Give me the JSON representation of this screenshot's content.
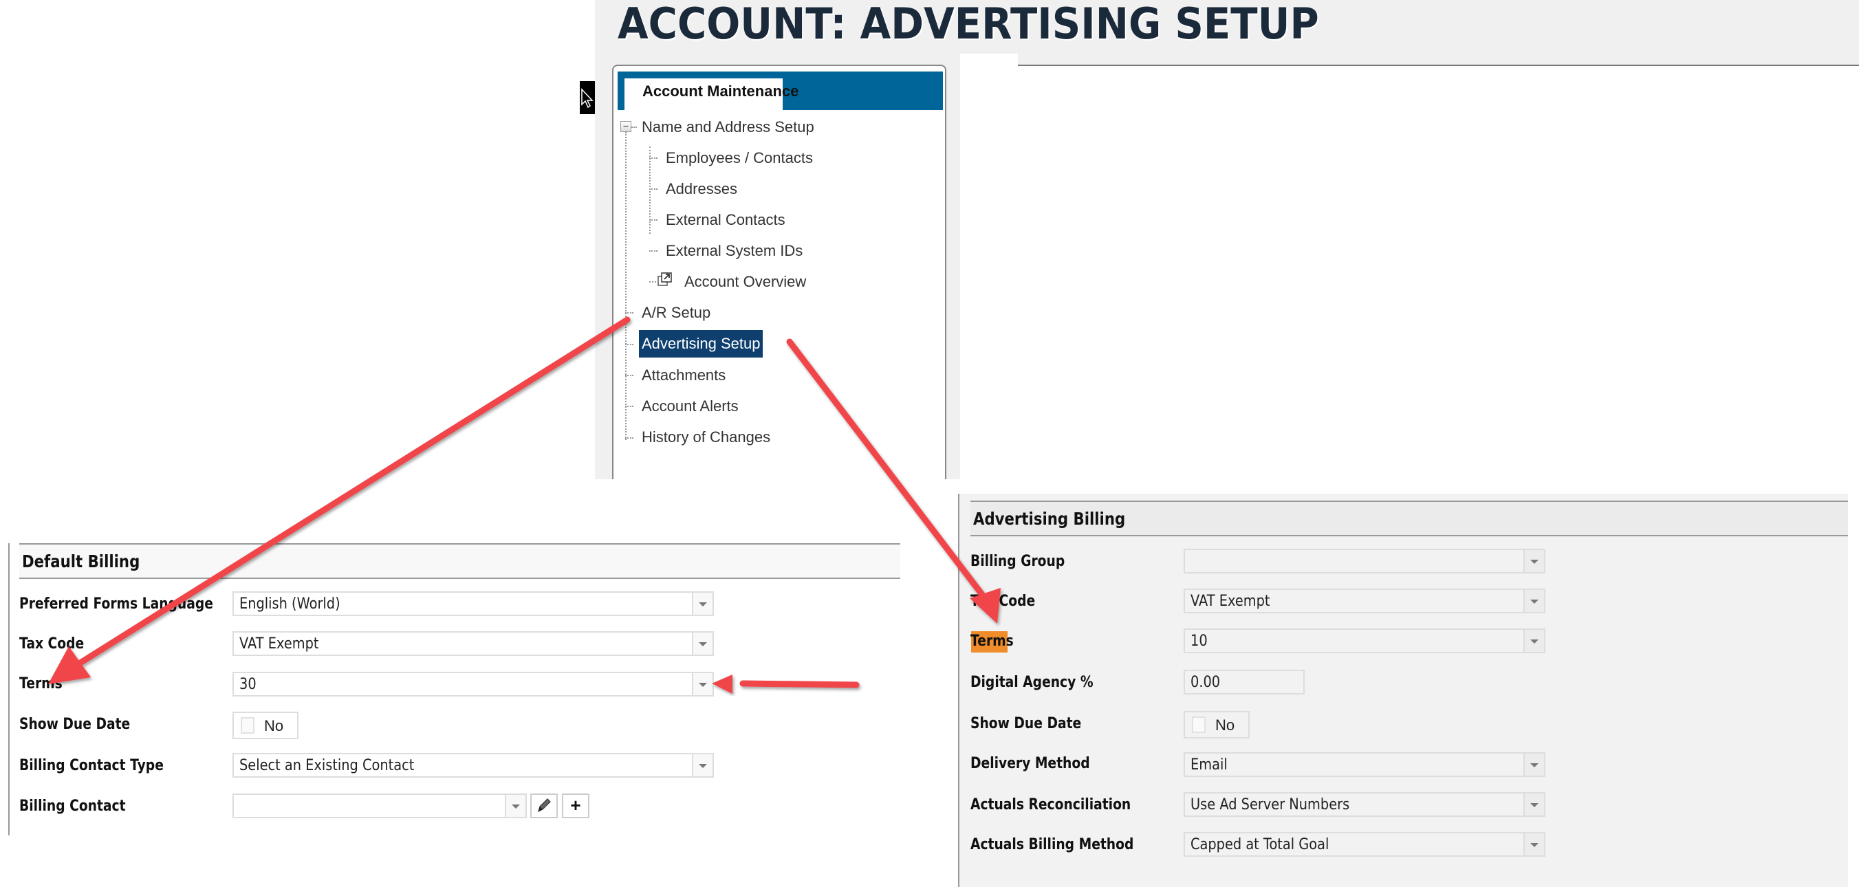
{
  "page": {
    "title": "ACCOUNT: ADVERTISING SETUP"
  },
  "tree": {
    "section_tab": "Account Maintenance",
    "items": [
      {
        "label": "Name and Address Setup",
        "level": 0,
        "expanded": true
      },
      {
        "label": "Employees / Contacts",
        "level": 1
      },
      {
        "label": "Addresses",
        "level": 1
      },
      {
        "label": "External Contacts",
        "level": 1
      },
      {
        "label": "External System IDs",
        "level": 1
      },
      {
        "label": "Account Overview",
        "level": 1,
        "icon": "external-window-icon"
      },
      {
        "label": "A/R Setup",
        "level": 0
      },
      {
        "label": "Advertising Setup",
        "level": 0,
        "selected": true
      },
      {
        "label": "Attachments",
        "level": 0
      },
      {
        "label": "Account Alerts",
        "level": 0
      },
      {
        "label": "History of Changes",
        "level": 0
      }
    ]
  },
  "default_billing": {
    "title": "Default Billing",
    "fields": {
      "preferred_forms_language": {
        "label": "Preferred Forms Language",
        "value": "English (World)"
      },
      "tax_code": {
        "label": "Tax Code",
        "value": "VAT Exempt"
      },
      "terms": {
        "label": "Terms",
        "value": "30"
      },
      "show_due_date": {
        "label": "Show Due Date",
        "value": "No",
        "checked": false
      },
      "billing_contact_type": {
        "label": "Billing Contact Type",
        "value": "Select an Existing Contact"
      },
      "billing_contact": {
        "label": "Billing Contact",
        "value": ""
      }
    },
    "buttons": {
      "edit_icon": "pencil-icon",
      "add_label": "+"
    }
  },
  "advertising_billing": {
    "title": "Advertising Billing",
    "fields": {
      "billing_group": {
        "label": "Billing Group",
        "value": ""
      },
      "tax_code": {
        "label": "Tax Code",
        "value": "VAT Exempt"
      },
      "terms": {
        "label": "Terms",
        "value": "10",
        "highlighted": true
      },
      "digital_agency_pct": {
        "label": "Digital Agency %",
        "value": "0.00"
      },
      "show_due_date": {
        "label": "Show Due Date",
        "value": "No",
        "checked": false
      },
      "delivery_method": {
        "label": "Delivery Method",
        "value": "Email"
      },
      "actuals_reconciliation": {
        "label": "Actuals Reconciliation",
        "value": "Use Ad Server Numbers"
      },
      "actuals_billing_method": {
        "label": "Actuals Billing Method",
        "value": "Capped at Total Goal"
      }
    }
  },
  "colors": {
    "brand_blue": "#006699",
    "selected_bg": "#0e3f6f",
    "annotation_arrow": "#f0454a",
    "highlight": "#f08c2a",
    "title_text": "#1b2a3a"
  }
}
